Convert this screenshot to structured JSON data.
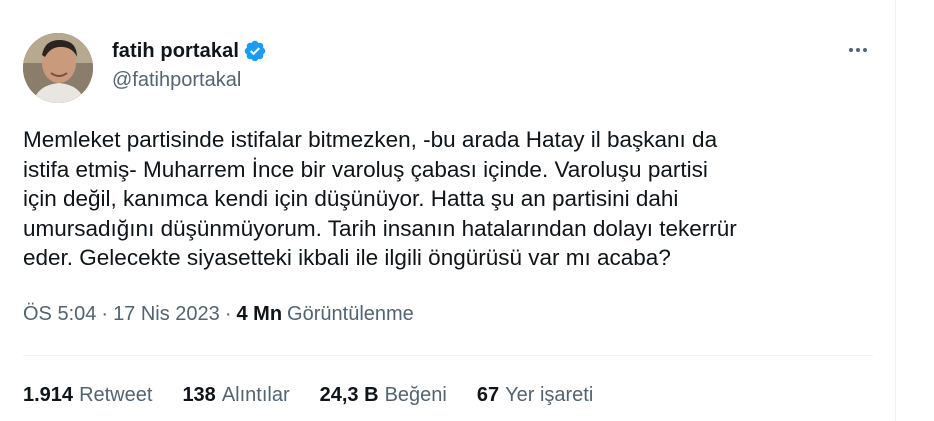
{
  "author": {
    "display_name": "fatih portakal",
    "handle": "@fatihportakal",
    "verified": true,
    "verified_color": "#1d9bf0"
  },
  "tweet": {
    "text": "Memleket partisinde istifalar bitmezken, -bu arada Hatay il başkanı da\nistifa etmiş- Muharrem İnce bir varoluş çabası içinde. Varoluşu partisi\niçin değil, kanımca kendi için düşünüyor. Hatta şu an partisini dahi\numursadığını düşünmüyorum. Tarih insanın hatalarından dolayı tekerrür\neder. Gelecekte siyasetteki ikbali ile ilgili öngürüsü var mı acaba?"
  },
  "meta": {
    "time": "ÖS 5:04",
    "separator": "·",
    "date": "17 Nis 2023",
    "views_count": "4 Mn",
    "views_label": "Görüntülenme"
  },
  "stats": [
    {
      "count": "1.914",
      "label": "Retweet"
    },
    {
      "count": "138",
      "label": "Alıntılar"
    },
    {
      "count": "24,3 B",
      "label": "Beğeni"
    },
    {
      "count": "67",
      "label": "Yer işareti"
    }
  ],
  "icons": {
    "more": "more-horizontal-icon",
    "verified": "verified-badge-icon"
  },
  "colors": {
    "text_primary": "#0f1419",
    "text_secondary": "#536471",
    "divider": "#eff3f4"
  }
}
